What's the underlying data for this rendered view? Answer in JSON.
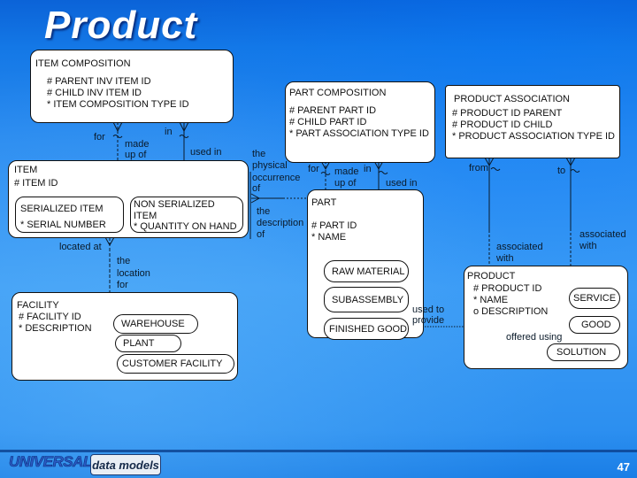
{
  "slide": {
    "title": "Product",
    "page_number": "47",
    "logo": {
      "primary": "UNIVERSAL",
      "secondary": "data models"
    }
  },
  "entities": {
    "item_composition": {
      "name": "ITEM COMPOSITION",
      "attributes": [
        "# PARENT INV ITEM ID",
        "# CHILD INV ITEM ID",
        "* ITEM COMPOSITION TYPE ID"
      ]
    },
    "part_composition": {
      "name": "PART COMPOSITION",
      "attributes": [
        "# PARENT PART ID",
        "# CHILD PART ID",
        "* PART ASSOCIATION TYPE ID"
      ]
    },
    "product_association": {
      "name": "PRODUCT ASSOCIATION",
      "attributes": [
        "# PRODUCT ID PARENT",
        "# PRODUCT ID CHILD",
        "* PRODUCT ASSOCIATION TYPE ID"
      ]
    },
    "item": {
      "name": "ITEM",
      "attributes": [
        "# ITEM ID"
      ],
      "subtypes": {
        "serialized": {
          "name": "SERIALIZED ITEM",
          "attribute": "* SERIAL NUMBER"
        },
        "non_serialized": {
          "name_line1": "NON SERIALIZED",
          "name_line2": "ITEM",
          "attribute": "* QUANTITY ON HAND"
        }
      }
    },
    "part": {
      "name": "PART",
      "attributes": [
        "# PART ID",
        "* NAME"
      ],
      "subtypes": [
        "RAW MATERIAL",
        "SUBASSEMBLY",
        "FINISHED GOOD"
      ]
    },
    "facility": {
      "name": "FACILITY",
      "attributes": [
        "# FACILITY ID",
        "* DESCRIPTION"
      ],
      "subtypes": [
        "WAREHOUSE",
        "PLANT",
        "CUSTOMER FACILITY"
      ]
    },
    "product": {
      "name": "PRODUCT",
      "attributes": [
        "# PRODUCT ID",
        "* NAME",
        "o DESCRIPTION"
      ],
      "subtypes": [
        "SERVICE",
        "GOOD",
        "SOLUTION"
      ]
    }
  },
  "relationships": {
    "ic_for": "for",
    "ic_made_up_of_1": "made",
    "ic_made_up_of_2": "up of",
    "ic_in": "in",
    "ic_used_in": "used in",
    "pc_for": "for",
    "pc_made_1": "made",
    "pc_made_2": "up of",
    "pc_in": "in",
    "pc_used_in": "used in",
    "pa_from": "from",
    "pa_to": "to",
    "pa_assoc_1a": "associated",
    "pa_assoc_1b": "with",
    "pa_assoc_2a": "associated",
    "pa_assoc_2b": "with",
    "item_part_1": [
      "the",
      "physical",
      "occurrence",
      "of"
    ],
    "item_part_2": [
      "the",
      "description",
      "of"
    ],
    "item_located_at": "located at",
    "facility_location_for": [
      "the",
      "location",
      "for"
    ],
    "finished_used_to_1": "used to",
    "finished_used_to_2": "provide",
    "good_offered_using": "offered using"
  }
}
